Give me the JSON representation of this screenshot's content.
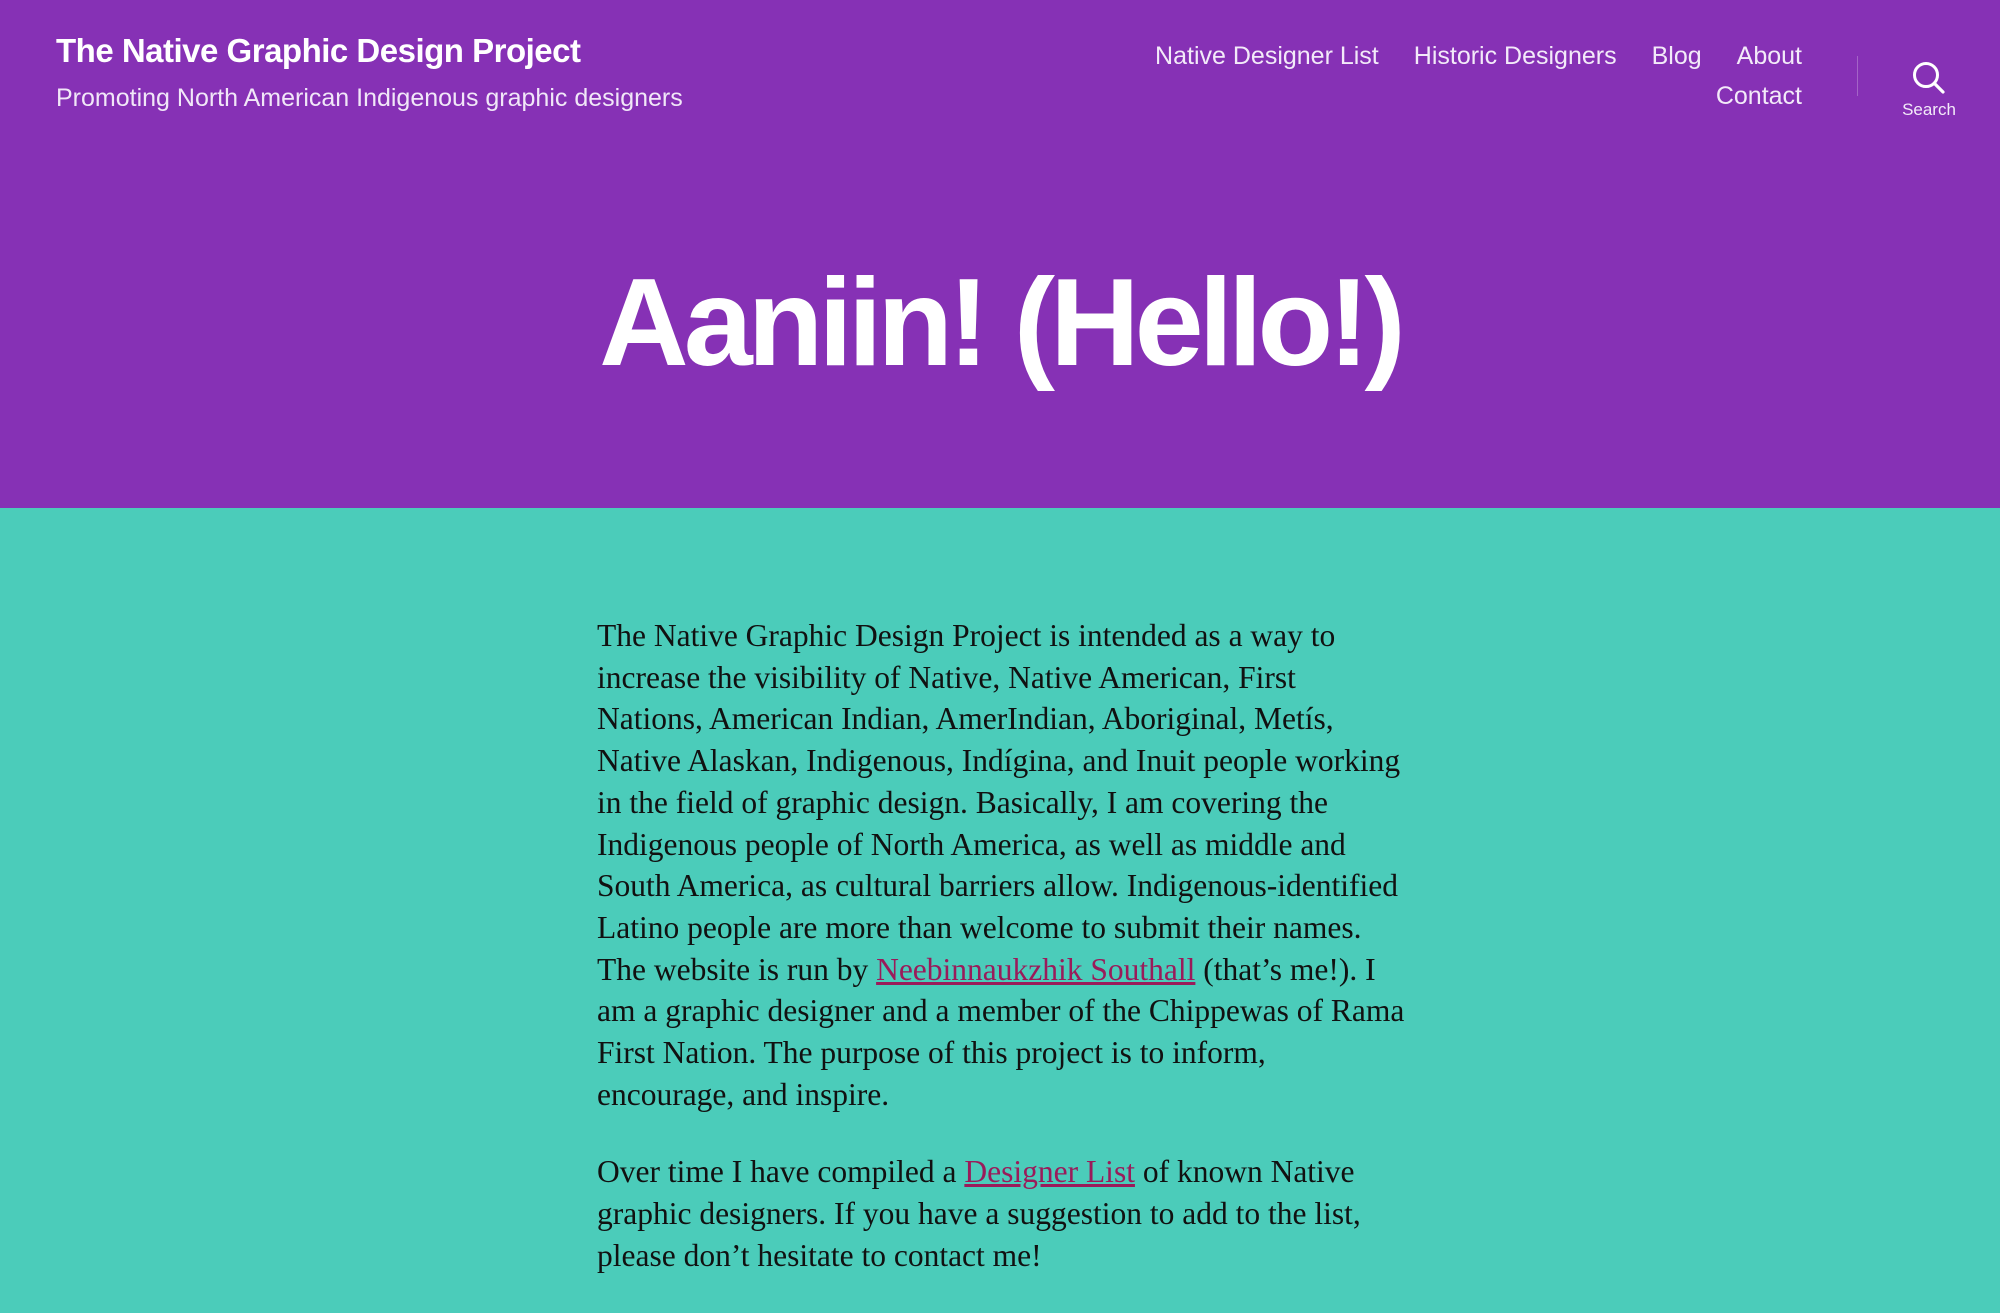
{
  "header": {
    "site_title": "The Native Graphic Design Project",
    "site_description": "Promoting North American Indigenous graphic designers",
    "nav": [
      {
        "label": "Native Designer List"
      },
      {
        "label": "Historic Designers"
      },
      {
        "label": "Blog"
      },
      {
        "label": "About"
      },
      {
        "label": "Contact"
      }
    ],
    "search": {
      "label": "Search",
      "icon": "search-icon"
    }
  },
  "hero": {
    "title": "Aaniin! (Hello!)"
  },
  "content": {
    "p1_text_before": "The Native Graphic Design Project is intended as a way to increase the visibility of Native, Native American, First Nations, American Indian, AmerIndian, Aboriginal, Metís, Native Alaskan, Indigenous, Indígina, and Inuit people working in the field of graphic design. Basically, I am covering the Indigenous people of North America, as well as middle and South America, as cultural barriers allow. Indigenous-identified Latino people are more than welcome to submit their names. The website is run by ",
    "p1_link": "Neebinnaukzhik Southall",
    "p1_text_after": " (that’s me!). I am a graphic designer and a member of the Chippewas of Rama First Nation. The purpose of this project is to inform, encourage, and inspire.",
    "p2_text_before": "Over time I have compiled a ",
    "p2_link": "Designer List",
    "p2_text_after": " of known Native graphic designers. If you have a suggestion to add to the list, please don’t hesitate to contact me!"
  },
  "colors": {
    "header_bg": "#8631b5",
    "content_bg": "#4bccba",
    "link": "#9a1b5a",
    "text": "#111111"
  }
}
